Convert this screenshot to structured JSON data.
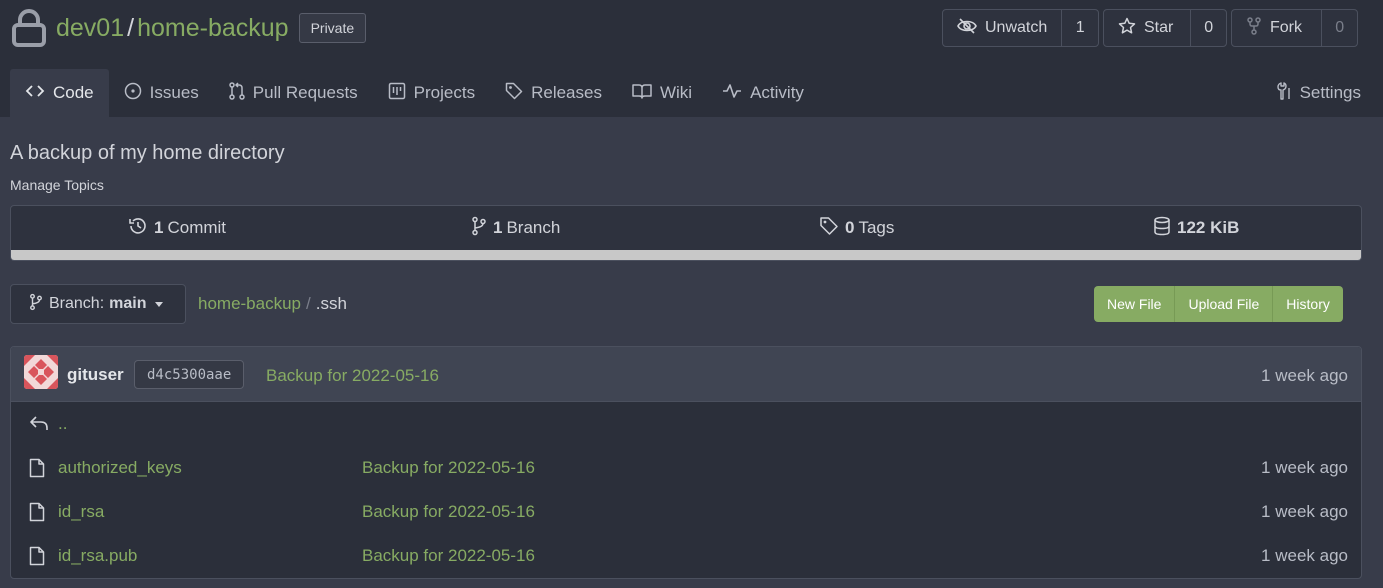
{
  "repo": {
    "owner": "dev01",
    "separator": "/",
    "name": "home-backup",
    "visibility": "Private",
    "description": "A backup of my home directory",
    "manage_topics": "Manage Topics"
  },
  "actions": {
    "unwatch_label": "Unwatch",
    "unwatch_count": "1",
    "star_label": "Star",
    "star_count": "0",
    "fork_label": "Fork",
    "fork_count": "0"
  },
  "tabs": {
    "code": "Code",
    "issues": "Issues",
    "pull_requests": "Pull Requests",
    "projects": "Projects",
    "releases": "Releases",
    "wiki": "Wiki",
    "activity": "Activity",
    "settings": "Settings"
  },
  "stats": {
    "commits_count": "1",
    "commits_label": "Commit",
    "branches_count": "1",
    "branches_label": "Branch",
    "tags_count": "0",
    "tags_label": "Tags",
    "size": "122 KiB"
  },
  "branch_selector": {
    "label": "Branch:",
    "value": "main"
  },
  "breadcrumb": {
    "root": "home-backup",
    "separator": "/",
    "current": ".ssh"
  },
  "file_actions": {
    "new_file": "New File",
    "upload_file": "Upload File",
    "history": "History"
  },
  "latest_commit": {
    "author": "gituser",
    "sha": "d4c5300aae",
    "message": "Backup for 2022-05-16",
    "age": "1 week ago"
  },
  "files": {
    "parent": "..",
    "rows": [
      {
        "name": "authorized_keys",
        "message": "Backup for 2022-05-16",
        "age": "1 week ago"
      },
      {
        "name": "id_rsa",
        "message": "Backup for 2022-05-16",
        "age": "1 week ago"
      },
      {
        "name": "id_rsa.pub",
        "message": "Backup for 2022-05-16",
        "age": "1 week ago"
      }
    ]
  },
  "colors": {
    "accent_green": "#87ab63",
    "header_bg": "#2b2f3a",
    "page_bg": "#383c4a"
  }
}
